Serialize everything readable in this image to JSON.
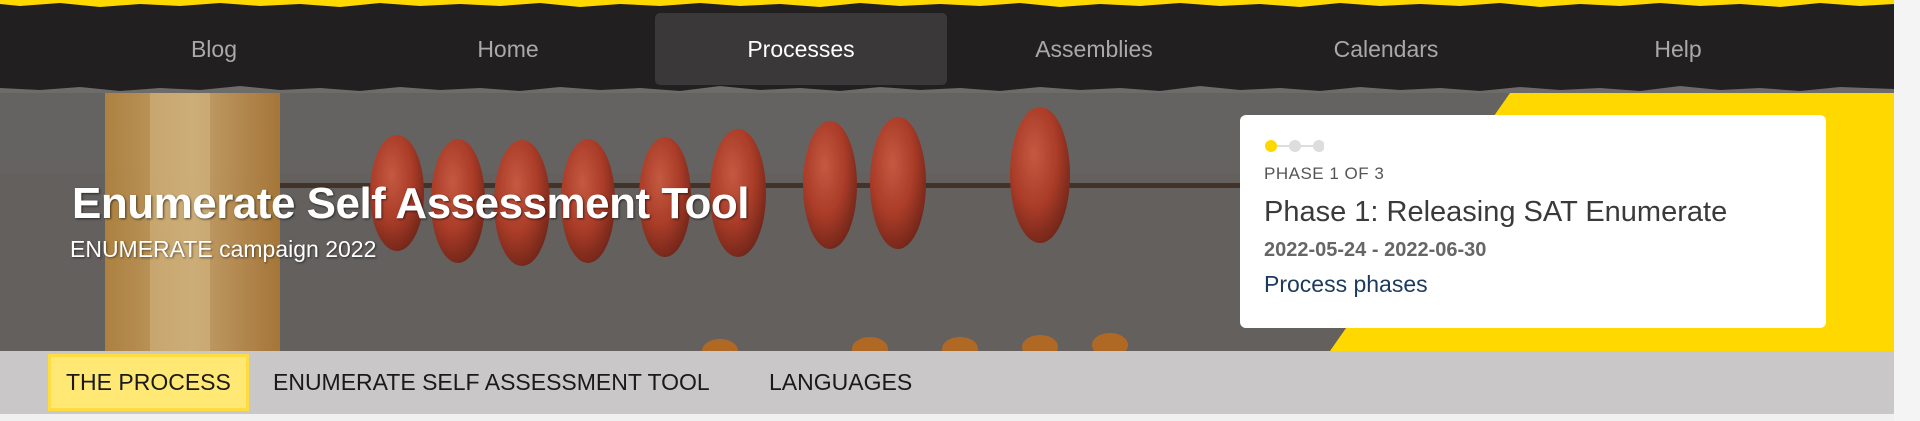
{
  "colors": {
    "nav_background": "#221f20",
    "accent_yellow": "#ffd800",
    "active_tab_background": "#3a3838",
    "subnav_background": "#c9c7c8",
    "subnav_active_background": "#ffe873",
    "link_color": "#1c3a5c"
  },
  "topnav": {
    "items": [
      {
        "label": "Blog",
        "active": false
      },
      {
        "label": "Home",
        "active": false
      },
      {
        "label": "Processes",
        "active": true
      },
      {
        "label": "Assemblies",
        "active": false
      },
      {
        "label": "Calendars",
        "active": false
      },
      {
        "label": "Help",
        "active": false
      }
    ]
  },
  "hero": {
    "title": "Enumerate Self Assessment Tool",
    "subtitle": "ENUMERATE campaign 2022",
    "background_image": "abacus-beads"
  },
  "phase": {
    "progress_current": 1,
    "progress_total": 3,
    "count_label": "PHASE 1 OF 3",
    "title": "Phase 1: Releasing SAT Enumerate",
    "dates": "2022-05-24 - 2022-06-30",
    "link_label": "Process phases"
  },
  "subnav": {
    "items": [
      {
        "label": "THE PROCESS",
        "active": true
      },
      {
        "label": "ENUMERATE SELF ASSESSMENT TOOL",
        "active": false
      },
      {
        "label": "LANGUAGES",
        "active": false
      }
    ]
  }
}
